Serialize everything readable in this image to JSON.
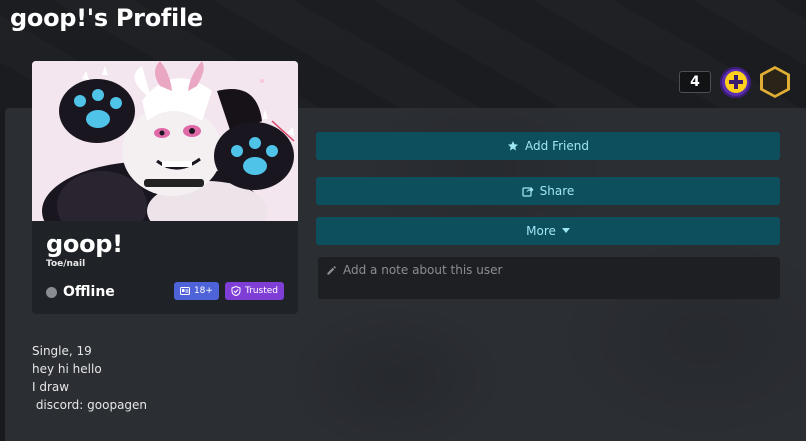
{
  "page": {
    "title": "goop!'s Profile"
  },
  "header_badges": {
    "count": "4"
  },
  "profile": {
    "display_name": "goop!",
    "pronouns": "Toe/nail",
    "status": "Offline",
    "tags": {
      "age": "18+",
      "trusted": "Trusted"
    }
  },
  "actions": {
    "add_friend": "Add Friend",
    "share": "Share",
    "more": "More"
  },
  "note": {
    "placeholder": "Add a note about this user"
  },
  "bio": {
    "lines": [
      "Single, 19",
      "hey hi hello",
      "I draw",
      " discord: goopagen"
    ]
  },
  "colors": {
    "accent_button": "#0e4f5e",
    "accent_text": "#9fe6f5",
    "age_tag": "#4f63d8",
    "trusted_tag": "#7f3fd6",
    "status_offline": "#8a8d92"
  },
  "icons": {
    "add_friend": "star-icon",
    "share": "share-icon",
    "more": "caret-down-icon",
    "note": "pencil-icon"
  }
}
